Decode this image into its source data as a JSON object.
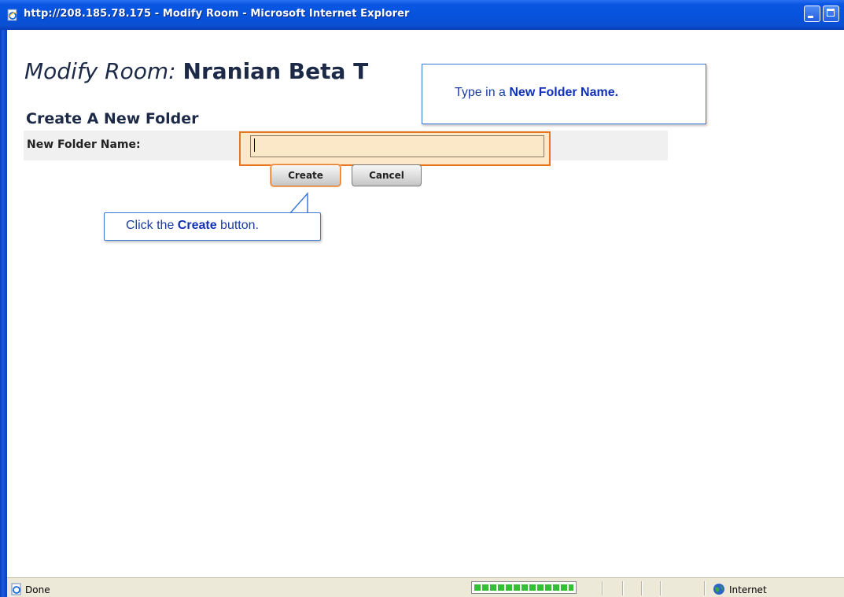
{
  "window": {
    "title": "http://208.185.78.175 - Modify Room - Microsoft Internet Explorer",
    "title_icon": "ie-page-icon",
    "minimize_icon": "minimize-icon",
    "maximize_icon": "maximize-icon",
    "titlebar_color": "#0553dc"
  },
  "page": {
    "title_prefix": "Modify Room:",
    "room_name": "Nranian Beta T",
    "section_title": "Create A New Folder"
  },
  "form": {
    "field_label": "New Folder Name:",
    "field_value": "",
    "create_label": "Create",
    "cancel_label": "Cancel",
    "highlight_color": "#e87722"
  },
  "callouts": {
    "type_prefix": "Type in a ",
    "type_emphasis": "New Folder Name.",
    "click_prefix": "Click the ",
    "click_emphasis": "Create",
    "click_suffix": " button.",
    "accent_color": "#3a7bd5"
  },
  "statusbar": {
    "status_text": "Done",
    "status_icon": "ie-page-icon",
    "progress": 1.0,
    "zone_text": "Internet",
    "zone_icon": "globe-icon"
  }
}
